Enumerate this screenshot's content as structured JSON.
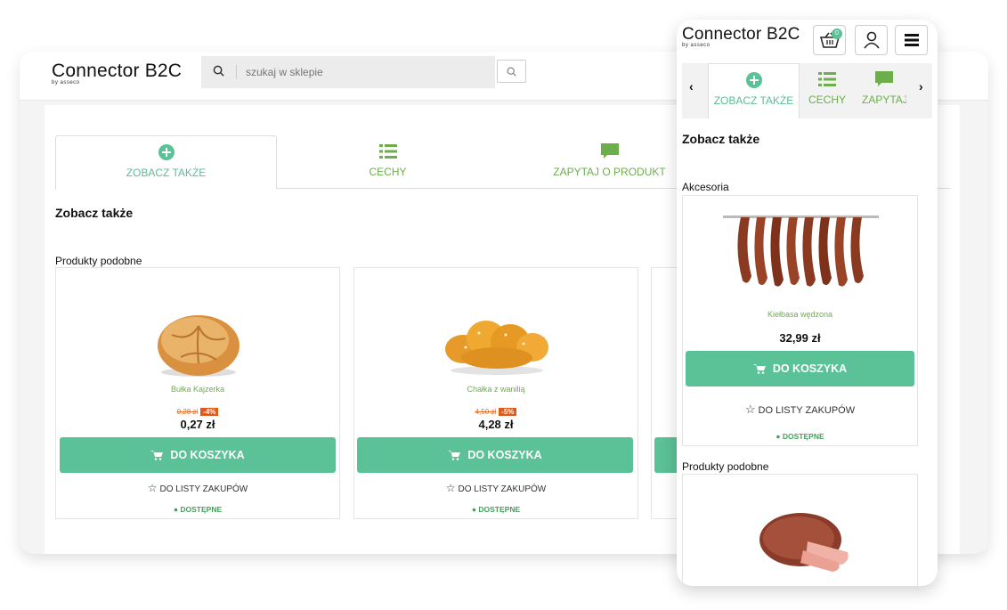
{
  "brand": {
    "name": "Connector B2C",
    "sub": "by asseco"
  },
  "search": {
    "placeholder": "szukaj w sklepie"
  },
  "tabs": [
    {
      "label": "ZOBACZ TAKŻE",
      "icon": "plus-circle-icon"
    },
    {
      "label": "CECHY",
      "icon": "list-icon"
    },
    {
      "label": "ZAPYTAJ O PRODUKT",
      "icon": "chat-icon"
    }
  ],
  "mobile_tabs": [
    {
      "label": "ZOBACZ TAKŻE",
      "icon": "plus-circle-icon"
    },
    {
      "label": "CECHY",
      "icon": "list-icon"
    },
    {
      "label": "ZAPYTAJ",
      "icon": "chat-icon"
    }
  ],
  "section": {
    "title": "Zobacz także",
    "similar": "Produkty podobne",
    "accessories": "Akcesoria"
  },
  "actions": {
    "cart": "DO KOSZYKA",
    "list": "DO LISTY ZAKUPÓW",
    "available": "DOSTĘPNE"
  },
  "cart": {
    "count": "0"
  },
  "products": [
    {
      "name": "Bułka Kajzerka",
      "old_price": "0,28 zł",
      "discount": "-4%",
      "price": "0,27 zł"
    },
    {
      "name": "Chałka z wanilią",
      "old_price": "4,50 zł",
      "discount": "-5%",
      "price": "4,28 zł"
    }
  ],
  "mobile_product": {
    "name": "Kiełbasa wędzona",
    "price": "32,99 zł"
  },
  "colors": {
    "accent": "#5bc197",
    "green_text": "#6cae4a",
    "discount": "#e05a1c"
  }
}
